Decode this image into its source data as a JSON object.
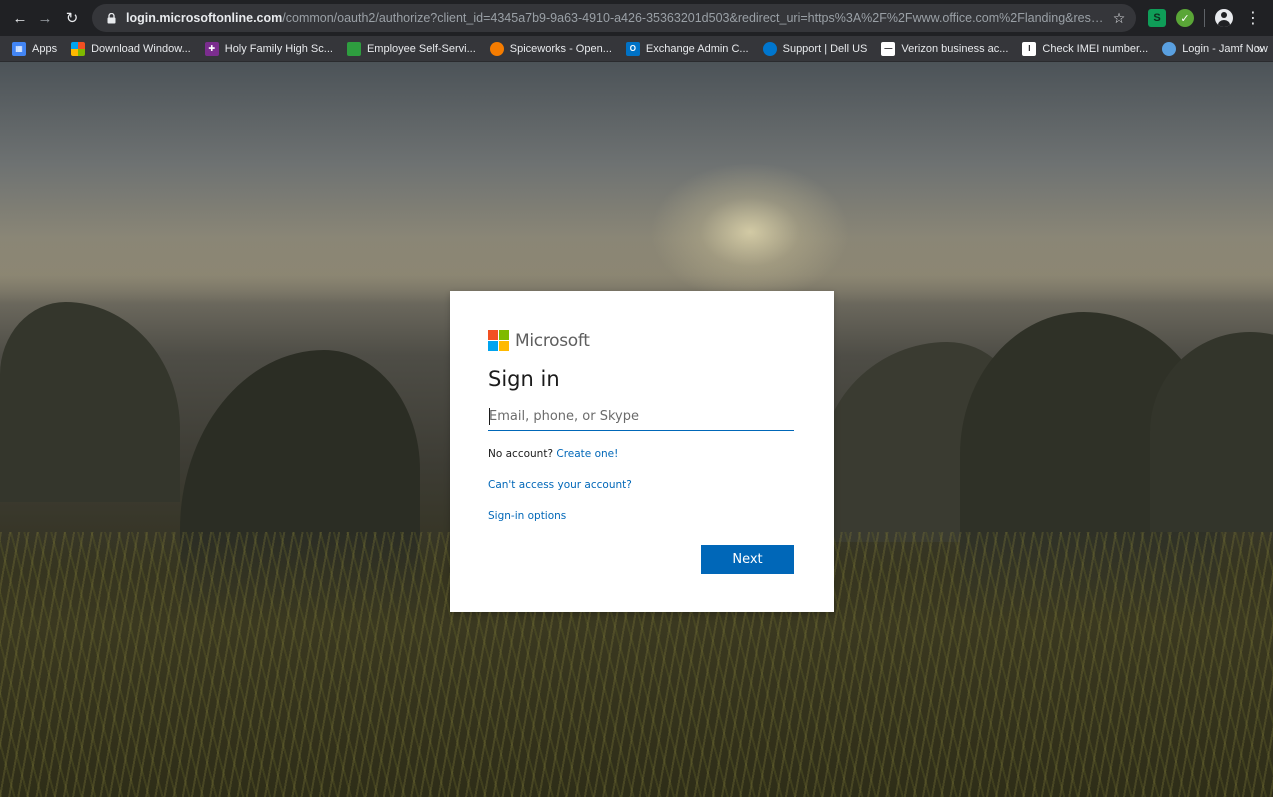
{
  "browser": {
    "url_host": "login.microsoftonline.com",
    "url_path": "/common/oauth2/authorize?client_id=4345a7b9-9a63-4910-a426-35363201d503&redirect_uri=https%3A%2F%2Fwww.office.com%2Flanding&response_t..."
  },
  "bookmarks": [
    {
      "label": "Apps",
      "icon": "apps-grid-icon",
      "color": "#4285f4"
    },
    {
      "label": "Download Window...",
      "icon": "windows-icon",
      "color": "#f25022"
    },
    {
      "label": "Holy Family High Sc...",
      "icon": "school-icon",
      "color": "#7b2d8e"
    },
    {
      "label": "Employee Self-Servi...",
      "icon": "employee-icon",
      "color": "#2e9e3f"
    },
    {
      "label": "Spiceworks - Open...",
      "icon": "spiceworks-icon",
      "color": "#f57c00"
    },
    {
      "label": "Exchange Admin C...",
      "icon": "outlook-icon",
      "color": "#0072c6"
    },
    {
      "label": "Support | Dell US",
      "icon": "dell-icon",
      "color": "#0076ce"
    },
    {
      "label": "Verizon business ac...",
      "icon": "verizon-icon",
      "color": "#ffffff"
    },
    {
      "label": "Check IMEI number...",
      "icon": "imei-icon",
      "color": "#ffffff"
    },
    {
      "label": "Login - Jamf Now",
      "icon": "jamf-icon",
      "color": "#5aa0e0"
    }
  ],
  "signin": {
    "brand": "Microsoft",
    "title": "Sign in",
    "email_placeholder": "Email, phone, or Skype",
    "no_account_text": "No account?",
    "create_link": "Create one!",
    "cant_access": "Can't access your account?",
    "signin_options": "Sign-in options",
    "next_label": "Next"
  },
  "colors": {
    "accent": "#0067b8",
    "ms_red": "#f25022",
    "ms_green": "#7fba00",
    "ms_blue": "#00a4ef",
    "ms_yellow": "#ffb900"
  }
}
